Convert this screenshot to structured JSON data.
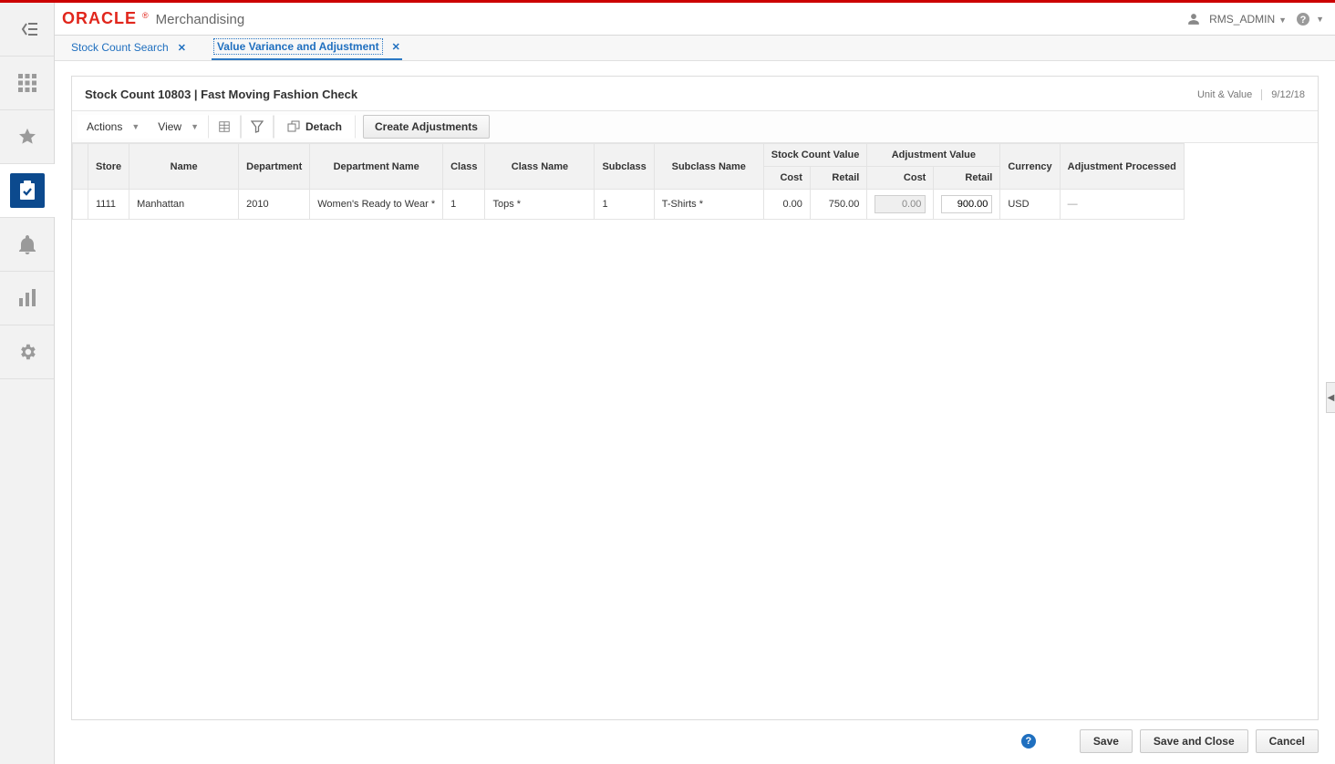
{
  "brand": {
    "logo": "ORACLE",
    "reg": "®",
    "product": "Merchandising"
  },
  "user": {
    "name": "RMS_ADMIN"
  },
  "tabs": [
    {
      "label": "Stock Count Search",
      "active": false
    },
    {
      "label": "Value Variance and Adjustment",
      "active": true
    }
  ],
  "panel": {
    "title": "Stock Count 10803 | Fast Moving Fashion Check",
    "meta_type": "Unit & Value",
    "meta_date": "9/12/18"
  },
  "toolbar": {
    "actions": "Actions",
    "view": "View",
    "detach": "Detach",
    "create_adjustments": "Create Adjustments"
  },
  "columns": {
    "store": "Store",
    "name": "Name",
    "department": "Department",
    "department_name": "Department Name",
    "class": "Class",
    "class_name": "Class Name",
    "subclass": "Subclass",
    "subclass_name": "Subclass Name",
    "stock_count_value": "Stock Count Value",
    "adjustment_value": "Adjustment Value",
    "cost": "Cost",
    "retail": "Retail",
    "currency": "Currency",
    "adjustment_processed": "Adjustment\nProcessed"
  },
  "rows": [
    {
      "store": "1111",
      "name": "Manhattan",
      "department": "2010",
      "department_name": "Women's Ready to Wear *",
      "class": "1",
      "class_name": "Tops *",
      "subclass": "1",
      "subclass_name": "T-Shirts *",
      "scv_cost": "0.00",
      "scv_retail": "750.00",
      "adj_cost": "0.00",
      "adj_retail": "900.00",
      "currency": "USD",
      "adj_processed": "—"
    }
  ],
  "footer": {
    "save": "Save",
    "save_close": "Save and Close",
    "cancel": "Cancel"
  }
}
